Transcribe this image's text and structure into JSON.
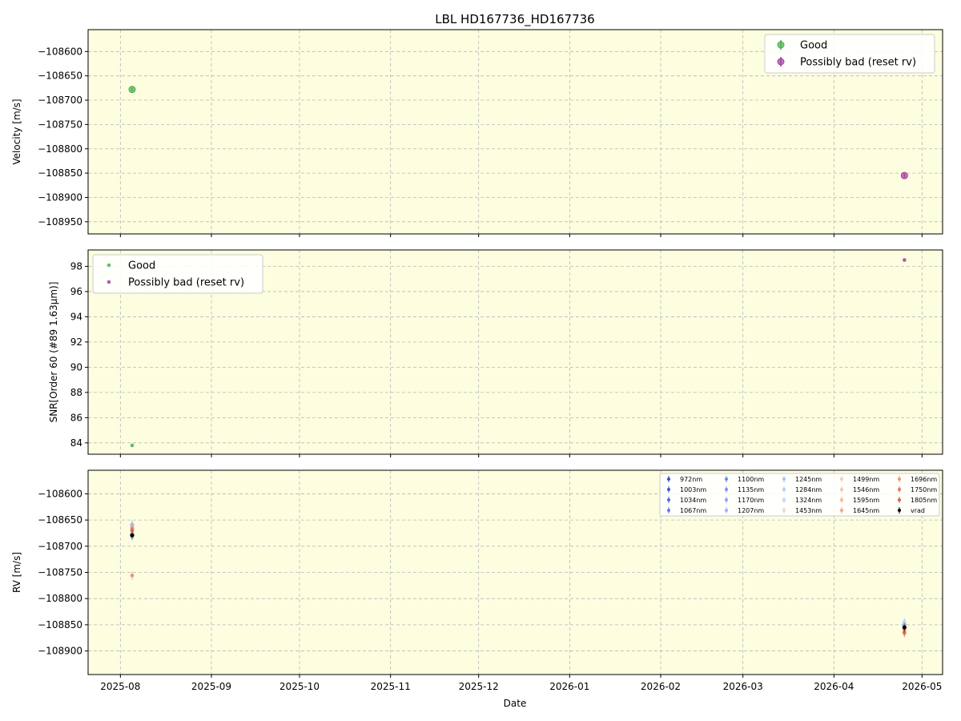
{
  "figure": {
    "title": "LBL HD167736_HD167736",
    "xlabel": "Date"
  },
  "x_ticks": [
    "2025-08",
    "2025-09",
    "2025-10",
    "2025-11",
    "2025-12",
    "2026-01",
    "2026-02",
    "2026-03",
    "2026-04",
    "2026-05"
  ],
  "colors": {
    "plot_bg": "#fdfde0",
    "good": "#4caf50",
    "bad": "#a040a0",
    "vrad": "#000000",
    "grid": "#b8b8b8"
  },
  "chart_data": [
    {
      "type": "scatter",
      "ylabel": "Velocity [m/s]",
      "xlim": [
        "2025-07-21",
        "2026-05-08"
      ],
      "ylim": [
        -108975,
        -108555
      ],
      "yticks": [
        -108600,
        -108650,
        -108700,
        -108750,
        -108800,
        -108850,
        -108900,
        -108950
      ],
      "legend": "top-right",
      "series": [
        {
          "name": "Good",
          "color": "#4caf50",
          "points": [
            {
              "x": "2025-08-05",
              "y": -108678,
              "err": 4
            }
          ]
        },
        {
          "name": "Possibly bad (reset rv)",
          "color": "#a040a0",
          "points": [
            {
              "x": "2026-04-25",
              "y": -108855,
              "err": 4
            }
          ]
        }
      ]
    },
    {
      "type": "scatter",
      "ylabel": "SNR[Order 60 (#89 1.63μm)]",
      "xlim": [
        "2025-07-21",
        "2026-05-08"
      ],
      "ylim": [
        83.1,
        99.3
      ],
      "yticks": [
        84,
        86,
        88,
        90,
        92,
        94,
        96,
        98
      ],
      "legend": "top-left",
      "series": [
        {
          "name": "Good",
          "color": "#4caf50",
          "points": [
            {
              "x": "2025-08-05",
              "y": 83.8
            }
          ]
        },
        {
          "name": "Possibly bad (reset rv)",
          "color": "#a040a0",
          "points": [
            {
              "x": "2026-04-25",
              "y": 98.5
            }
          ]
        }
      ]
    },
    {
      "type": "scatter",
      "ylabel": "RV [m/s]",
      "xlim": [
        "2025-07-21",
        "2026-05-08"
      ],
      "ylim": [
        -108945,
        -108555
      ],
      "yticks": [
        -108600,
        -108650,
        -108700,
        -108750,
        -108800,
        -108850,
        -108900
      ],
      "legend": "top-right",
      "series": [
        {
          "name": "972nm",
          "color": "#3b4cc0",
          "points": [
            {
              "x": "2025-08-05",
              "y": -108660
            },
            {
              "x": "2026-04-25",
              "y": -108852
            }
          ]
        },
        {
          "name": "1003nm",
          "color": "#4358cb",
          "points": [
            {
              "x": "2025-08-05",
              "y": -108664
            },
            {
              "x": "2026-04-25",
              "y": -108855
            }
          ]
        },
        {
          "name": "1034nm",
          "color": "#4f69d9",
          "points": [
            {
              "x": "2025-08-05",
              "y": -108668
            },
            {
              "x": "2026-04-25",
              "y": -108850
            }
          ]
        },
        {
          "name": "1067nm",
          "color": "#5a78e4",
          "points": [
            {
              "x": "2025-08-05",
              "y": -108672
            },
            {
              "x": "2026-04-25",
              "y": -108853
            }
          ]
        },
        {
          "name": "1100nm",
          "color": "#6788ee",
          "points": [
            {
              "x": "2025-08-05",
              "y": -108666
            },
            {
              "x": "2026-04-25",
              "y": -108856
            }
          ]
        },
        {
          "name": "1135nm",
          "color": "#7597f6",
          "points": [
            {
              "x": "2025-08-05",
              "y": -108676
            },
            {
              "x": "2026-04-25",
              "y": -108849
            }
          ]
        },
        {
          "name": "1170nm",
          "color": "#84a7fc",
          "points": [
            {
              "x": "2025-08-05",
              "y": -108682
            },
            {
              "x": "2026-04-25",
              "y": -108851
            }
          ]
        },
        {
          "name": "1207nm",
          "color": "#93b5fe",
          "points": [
            {
              "x": "2025-08-05",
              "y": -108658
            },
            {
              "x": "2026-04-25",
              "y": -108847
            }
          ]
        },
        {
          "name": "1245nm",
          "color": "#a2c1ff",
          "points": [
            {
              "x": "2025-08-05",
              "y": -108670
            },
            {
              "x": "2026-04-25",
              "y": -108845
            }
          ]
        },
        {
          "name": "1284nm",
          "color": "#b1cbfc",
          "points": [
            {
              "x": "2025-08-05",
              "y": -108662
            },
            {
              "x": "2026-04-25",
              "y": -108858
            }
          ]
        },
        {
          "name": "1324nm",
          "color": "#c0d4f5",
          "points": [
            {
              "x": "2025-08-05",
              "y": -108674
            },
            {
              "x": "2026-04-25",
              "y": -108846
            }
          ]
        },
        {
          "name": "1453nm",
          "color": "#e6d7cf",
          "points": [
            {
              "x": "2025-08-05",
              "y": -108668
            },
            {
              "x": "2026-04-25",
              "y": -108854
            }
          ]
        },
        {
          "name": "1499nm",
          "color": "#efcfbf",
          "points": [
            {
              "x": "2025-08-05",
              "y": -108663
            },
            {
              "x": "2026-04-25",
              "y": -108857
            }
          ]
        },
        {
          "name": "1546nm",
          "color": "#f4c5ad",
          "points": [
            {
              "x": "2025-08-05",
              "y": -108672
            },
            {
              "x": "2026-04-25",
              "y": -108859
            }
          ]
        },
        {
          "name": "1595nm",
          "color": "#f7b89c",
          "points": [
            {
              "x": "2025-08-05",
              "y": -108667
            },
            {
              "x": "2026-04-25",
              "y": -108860
            }
          ]
        },
        {
          "name": "1645nm",
          "color": "#f6a385",
          "points": [
            {
              "x": "2025-08-05",
              "y": -108670
            },
            {
              "x": "2026-04-25",
              "y": -108862
            }
          ]
        },
        {
          "name": "1696nm",
          "color": "#f39475",
          "points": [
            {
              "x": "2025-08-05",
              "y": -108665
            },
            {
              "x": "2026-04-25",
              "y": -108858
            }
          ]
        },
        {
          "name": "1750nm",
          "color": "#e7745b",
          "points": [
            {
              "x": "2025-08-05",
              "y": -108756
            },
            {
              "x": "2026-04-25",
              "y": -108864
            }
          ]
        },
        {
          "name": "1805nm",
          "color": "#dc5d4a",
          "points": [
            {
              "x": "2025-08-05",
              "y": -108669
            },
            {
              "x": "2026-04-25",
              "y": -108866
            }
          ]
        },
        {
          "name": "vrad",
          "color": "#000000",
          "points": [
            {
              "x": "2025-08-05",
              "y": -108679
            },
            {
              "x": "2026-04-25",
              "y": -108855
            }
          ]
        }
      ]
    }
  ]
}
